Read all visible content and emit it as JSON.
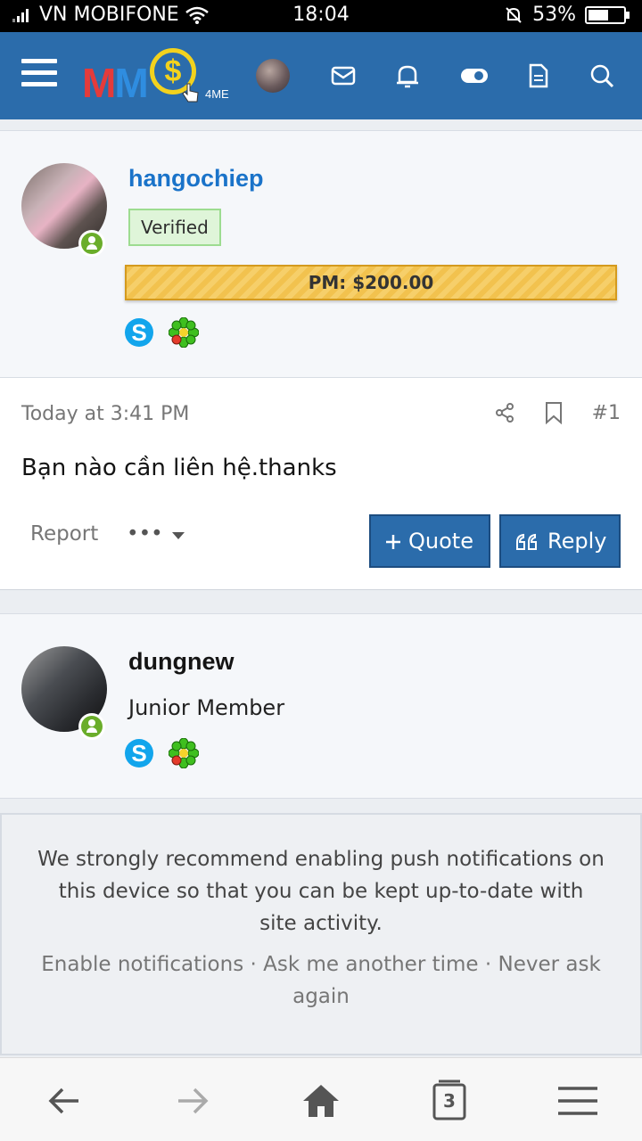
{
  "status_bar": {
    "carrier": "VN MOBIFONE",
    "time": "18:04",
    "battery": "53%",
    "battery_level": 0.53
  },
  "header": {
    "logo_text_1": "M",
    "logo_text_2": "M",
    "logo_coin": "$",
    "logo_tag": "4ME",
    "icons": [
      "menu-icon",
      "avatar",
      "mail-icon",
      "bell-icon",
      "toggle-icon",
      "document-icon",
      "search-icon"
    ]
  },
  "post": {
    "author": {
      "name": "hangochiep",
      "badge": "Verified",
      "pm": "PM: $200.00",
      "contacts": [
        "skype-icon",
        "icq-icon"
      ]
    },
    "time": "Today at 3:41 PM",
    "number": "#1",
    "body": "Bạn nào cần liên hệ.thanks",
    "report_label": "Report",
    "more_label": "•••",
    "quote_label": "Quote",
    "reply_label": "Reply"
  },
  "second_user": {
    "name": "dungnew",
    "role": "Junior Member",
    "contacts": [
      "skype-icon",
      "icq-icon"
    ]
  },
  "notice": {
    "message": "We strongly recommend enabling push notifications on this device so that you can be kept up-to-date with site activity.",
    "enable": "Enable notifications",
    "later": "Ask me another time",
    "never": "Never ask again",
    "separator": " · "
  },
  "navbar": {
    "tabs_count": "3",
    "icons": [
      "back-icon",
      "forward-icon",
      "home-icon",
      "tabs-icon",
      "menu-icon"
    ]
  },
  "colors": {
    "header_bg": "#2b6cab",
    "username_blue": "#1a73c9",
    "online_green": "#6aad2a",
    "pm_gold": "#f2c24e"
  }
}
